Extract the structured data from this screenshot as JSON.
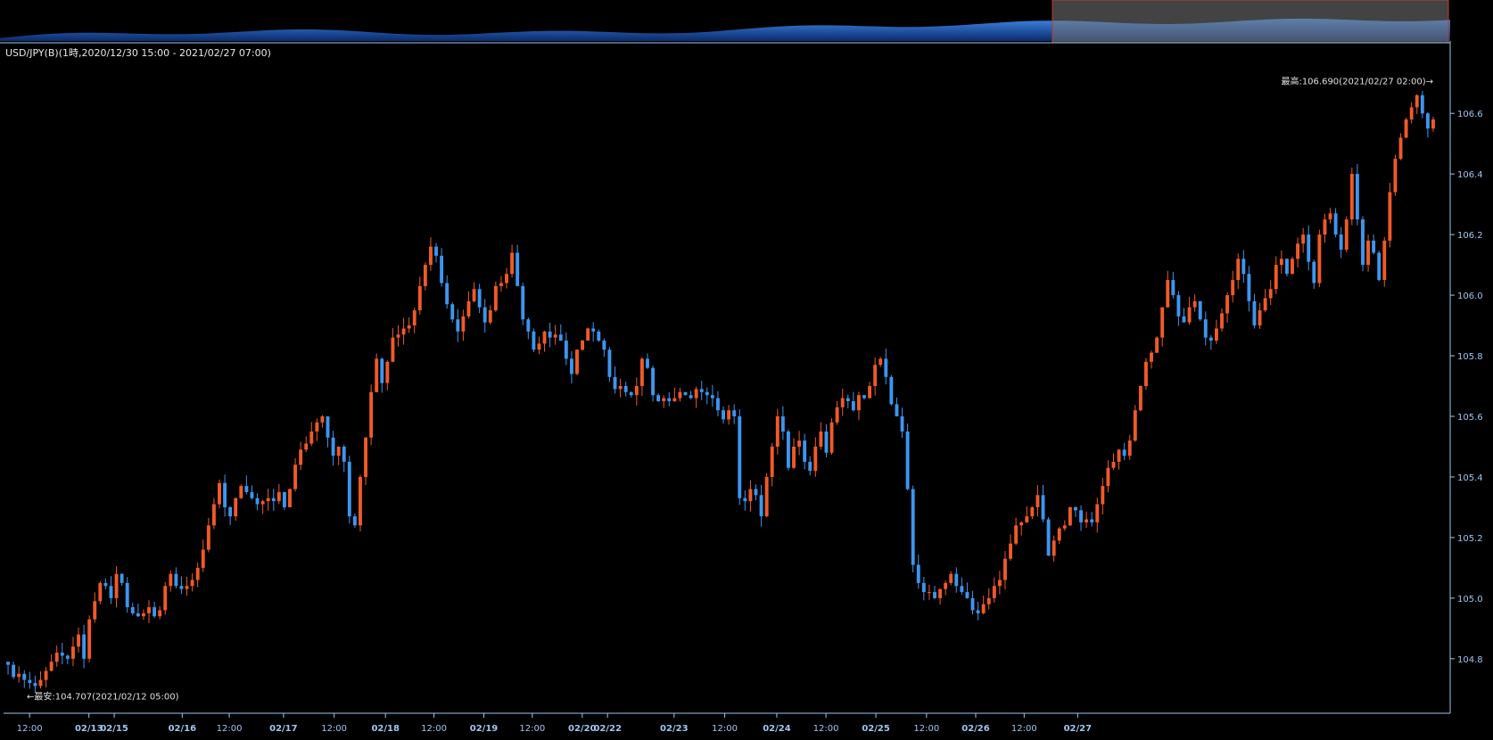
{
  "title": "USD/JPY(B)(1時,2020/12/30 15:00 - 2021/02/27 07:00)",
  "colors": {
    "background": "#000000",
    "up": "#f05a28",
    "down": "#3c96f0",
    "axis": "#9ec6f0",
    "navigator_fill": "#1f5fbf",
    "navigator_selection": "#7a7a7a"
  },
  "chart_data": {
    "type": "candlestick",
    "ylim": [
      104.62,
      106.78
    ],
    "y_ticks": [
      "104.8",
      "105.0",
      "105.2",
      "105.4",
      "105.6",
      "105.8",
      "106.0",
      "106.2",
      "106.4",
      "106.6"
    ],
    "y_tick_values": [
      104.8,
      105.0,
      105.2,
      105.4,
      105.6,
      105.8,
      106.0,
      106.2,
      106.4,
      106.6
    ],
    "x_labels": [
      {
        "label": "12:00",
        "pos": 0.036,
        "date": false
      },
      {
        "label": "02/13",
        "pos": 0.118,
        "date": true
      },
      {
        "label": "02/15",
        "pos": 0.153,
        "date": true
      },
      {
        "label": "02/16",
        "pos": 0.247,
        "date": true
      },
      {
        "label": "12:00",
        "pos": 0.312,
        "date": false
      },
      {
        "label": "02/17",
        "pos": 0.387,
        "date": true
      },
      {
        "label": "12:00",
        "pos": 0.457,
        "date": false
      },
      {
        "label": "02/18",
        "pos": 0.528,
        "date": true
      },
      {
        "label": "12:00",
        "pos": 0.595,
        "date": false
      },
      {
        "label": "02/19",
        "pos": 0.664,
        "date": true
      },
      {
        "label": "12:00",
        "pos": 0.731,
        "date": false
      },
      {
        "label": "02/20",
        "pos": 0.8,
        "date": true
      },
      {
        "label": "02/22",
        "pos": 0.835,
        "date": true
      },
      {
        "label": "02/23",
        "pos": 0.927,
        "date": true
      },
      {
        "label": "12:00",
        "pos": 0.997,
        "date": false
      }
    ],
    "x_labels_2": [
      {
        "label": "02/24",
        "pos": 0.069,
        "date": true
      },
      {
        "label": "12:00",
        "pos": 0.137,
        "date": false
      },
      {
        "label": "02/25",
        "pos": 0.206,
        "date": true
      },
      {
        "label": "12:00",
        "pos": 0.276,
        "date": false
      },
      {
        "label": "02/26",
        "pos": 0.344,
        "date": true
      },
      {
        "label": "12:00",
        "pos": 0.411,
        "date": false
      },
      {
        "label": "02/27",
        "pos": 0.485,
        "date": true
      }
    ],
    "high_label": "最高:106.690(2021/02/27 02:00)→",
    "low_label": "←最安:104.707(2021/02/12 05:00)",
    "high_value": 106.69,
    "low_value": 104.707,
    "closes": [
      104.78,
      104.74,
      104.75,
      104.73,
      104.72,
      104.71,
      104.73,
      104.76,
      104.79,
      104.82,
      104.81,
      104.8,
      104.84,
      104.88,
      104.8,
      104.93,
      104.99,
      105.05,
      105.04,
      105.0,
      105.08,
      105.05,
      104.97,
      104.95,
      104.94,
      104.95,
      104.97,
      104.94,
      104.96,
      105.04,
      105.08,
      105.04,
      105.03,
      105.04,
      105.06,
      105.1,
      105.16,
      105.24,
      105.31,
      105.38,
      105.3,
      105.27,
      105.33,
      105.37,
      105.35,
      105.33,
      105.31,
      105.32,
      105.33,
      105.32,
      105.35,
      105.3,
      105.36,
      105.44,
      105.49,
      105.51,
      105.55,
      105.58,
      105.6,
      105.53,
      105.47,
      105.5,
      105.45,
      105.27,
      105.24,
      105.4,
      105.53,
      105.68,
      105.79,
      105.71,
      105.78,
      105.86,
      105.87,
      105.89,
      105.9,
      105.95,
      106.03,
      106.1,
      106.16,
      106.13,
      106.04,
      105.97,
      105.92,
      105.88,
      105.93,
      105.98,
      106.02,
      105.96,
      105.91,
      105.95,
      106.03,
      106.04,
      106.07,
      106.14,
      106.03,
      105.92,
      105.88,
      105.82,
      105.84,
      105.88,
      105.86,
      105.87,
      105.85,
      105.79,
      105.74,
      105.82,
      105.85,
      105.89,
      105.88,
      105.85,
      105.82,
      105.73,
      105.69,
      105.7,
      105.68,
      105.67,
      105.7,
      105.79,
      105.76,
      105.67,
      105.65,
      105.66,
      105.65,
      105.66,
      105.68,
      105.67,
      105.66,
      105.69,
      105.68,
      105.67,
      105.66,
      105.62,
      105.59,
      105.62,
      105.6,
      105.33,
      105.32,
      105.36,
      105.34,
      105.27,
      105.4,
      105.5,
      105.6,
      105.55,
      105.43,
      105.5,
      105.52,
      105.45,
      105.42,
      105.5,
      105.55,
      105.48,
      105.58,
      105.63,
      105.66,
      105.65,
      105.62,
      105.67,
      105.66,
      105.7,
      105.77,
      105.79,
      105.73,
      105.64,
      105.6,
      105.55,
      105.36,
      105.11,
      105.05,
      105.02,
      105.02,
      105.0,
      105.03,
      105.05,
      105.08,
      105.04,
      105.02,
      105.0,
      104.96,
      104.95,
      104.98,
      105.0,
      105.04,
      105.06,
      105.13,
      105.18,
      105.24,
      105.25,
      105.27,
      105.3,
      105.34,
      105.26,
      105.14,
      105.19,
      105.23,
      105.24,
      105.3,
      105.29,
      105.25,
      105.26,
      105.25,
      105.31,
      105.37,
      105.43,
      105.45,
      105.49,
      105.47,
      105.52,
      105.62,
      105.7,
      105.78,
      105.81,
      105.86,
      105.96,
      106.05,
      106.0,
      105.93,
      105.91,
      105.96,
      105.98,
      105.92,
      105.86,
      105.85,
      105.89,
      105.94,
      106.0,
      106.05,
      106.12,
      106.07,
      105.98,
      105.9,
      105.95,
      105.99,
      106.02,
      106.1,
      106.12,
      106.07,
      106.12,
      106.17,
      106.2,
      106.11,
      106.04,
      106.2,
      106.25,
      106.27,
      106.2,
      106.15,
      106.25,
      106.4,
      106.25,
      106.1,
      106.18,
      106.14,
      106.05,
      106.18,
      106.34,
      106.45,
      106.52,
      106.58,
      106.62,
      106.66,
      106.6,
      106.55,
      106.58
    ]
  }
}
